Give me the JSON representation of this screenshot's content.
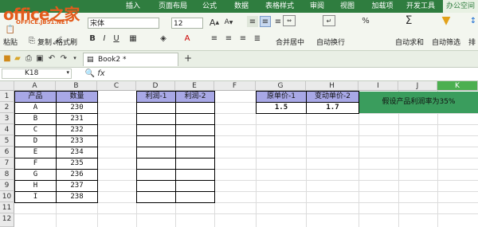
{
  "logo": {
    "text": "office之家",
    "subtext": "OFFICE.JB51.NET"
  },
  "menu": {
    "tabs": [
      "插入",
      "页面布局",
      "公式",
      "数据",
      "表格样式",
      "审阅",
      "视图",
      "加载项",
      "开发工具",
      "办公空间"
    ],
    "active": "办公空间"
  },
  "ribbon": {
    "font_name": "宋体",
    "font_size": "12",
    "paste": "粘贴",
    "copy": "复制",
    "format_painter": "格式刷",
    "merge_center": "合并居中",
    "wrap_text": "自动换行",
    "auto_sum": "自动求和",
    "auto_filter": "自动筛选",
    "sort_partial": "排",
    "bold": "B",
    "italic": "I",
    "underline": "U",
    "font_grow": "A",
    "font_shrink": "A",
    "percent": "%"
  },
  "quickbar": {
    "tab_title": "Book2 *",
    "new_tab": "+"
  },
  "formula_bar": {
    "cell_ref": "K18",
    "fx": "fx",
    "value": ""
  },
  "columns": [
    "A",
    "B",
    "C",
    "D",
    "E",
    "F",
    "G",
    "H",
    "I",
    "J",
    "K"
  ],
  "rows": [
    "1",
    "2",
    "3",
    "4",
    "5",
    "6",
    "7",
    "8",
    "9",
    "10",
    "11",
    "12"
  ],
  "cells": {
    "A1": "产品",
    "B1": "数量",
    "D1": "利润-1",
    "E1": "利润-2",
    "G1": "原单价-1",
    "H1": "变动单价-2",
    "G2": "1.5",
    "H2": "1.7",
    "I1": "假设产品利润率为35%",
    "A_col": [
      "A",
      "B",
      "C",
      "D",
      "E",
      "F",
      "G",
      "H",
      "I"
    ],
    "B_col": [
      "230",
      "231",
      "232",
      "233",
      "234",
      "235",
      "236",
      "237",
      "238"
    ]
  },
  "colors": {
    "menu_bg": "#2f7d3f",
    "header_fill": "#a8a8e6",
    "note_fill": "#3a9d5d",
    "active_col": "#4caf50"
  }
}
